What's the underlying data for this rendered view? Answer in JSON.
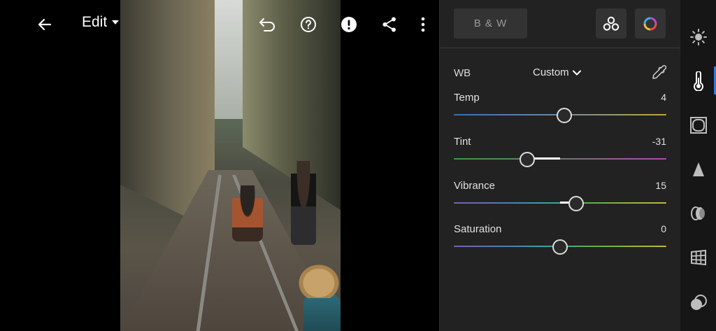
{
  "toolbar": {
    "edit_label": "Edit"
  },
  "panel": {
    "bw_label": "B & W",
    "wb": {
      "label": "WB",
      "value": "Custom"
    },
    "sliders": [
      {
        "label": "Temp",
        "value": "4",
        "level": 0.52,
        "fill_from": null
      },
      {
        "label": "Tint",
        "value": "-31",
        "level": 0.345,
        "fill_from": 0.5
      },
      {
        "label": "Vibrance",
        "value": "15",
        "level": 0.575,
        "fill_from": 0.5
      },
      {
        "label": "Saturation",
        "value": "0",
        "level": 0.5,
        "fill_from": null
      }
    ]
  },
  "rail": {
    "items": [
      "light-icon",
      "color-temperature-icon",
      "effects-icon",
      "detail-icon",
      "optics-icon",
      "geometry-icon",
      "masking-icon"
    ],
    "active": "color-temperature-icon"
  },
  "colors": {
    "panel_bg": "#222222",
    "rail_bg": "#161616",
    "accent": "#2e7be6"
  }
}
